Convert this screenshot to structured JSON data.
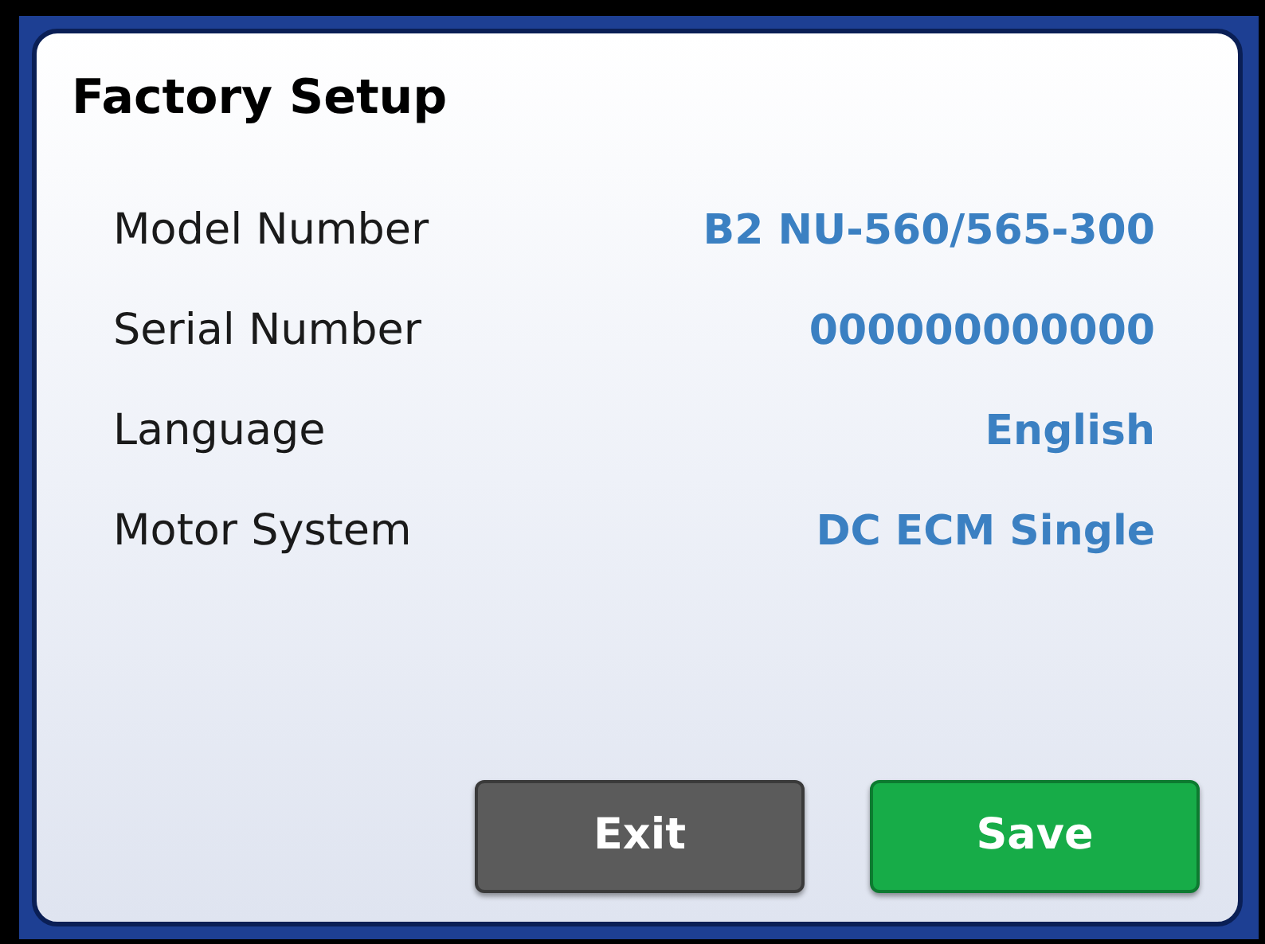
{
  "title": "Factory Setup",
  "settings": [
    {
      "label": "Model Number",
      "value": "B2 NU-560/565-300"
    },
    {
      "label": "Serial Number",
      "value": "000000000000"
    },
    {
      "label": "Language",
      "value": "English"
    },
    {
      "label": "Motor System",
      "value": "DC ECM Single"
    }
  ],
  "buttons": [
    {
      "label": "Exit",
      "kind": "secondary"
    },
    {
      "label": "Save",
      "kind": "primary"
    }
  ]
}
